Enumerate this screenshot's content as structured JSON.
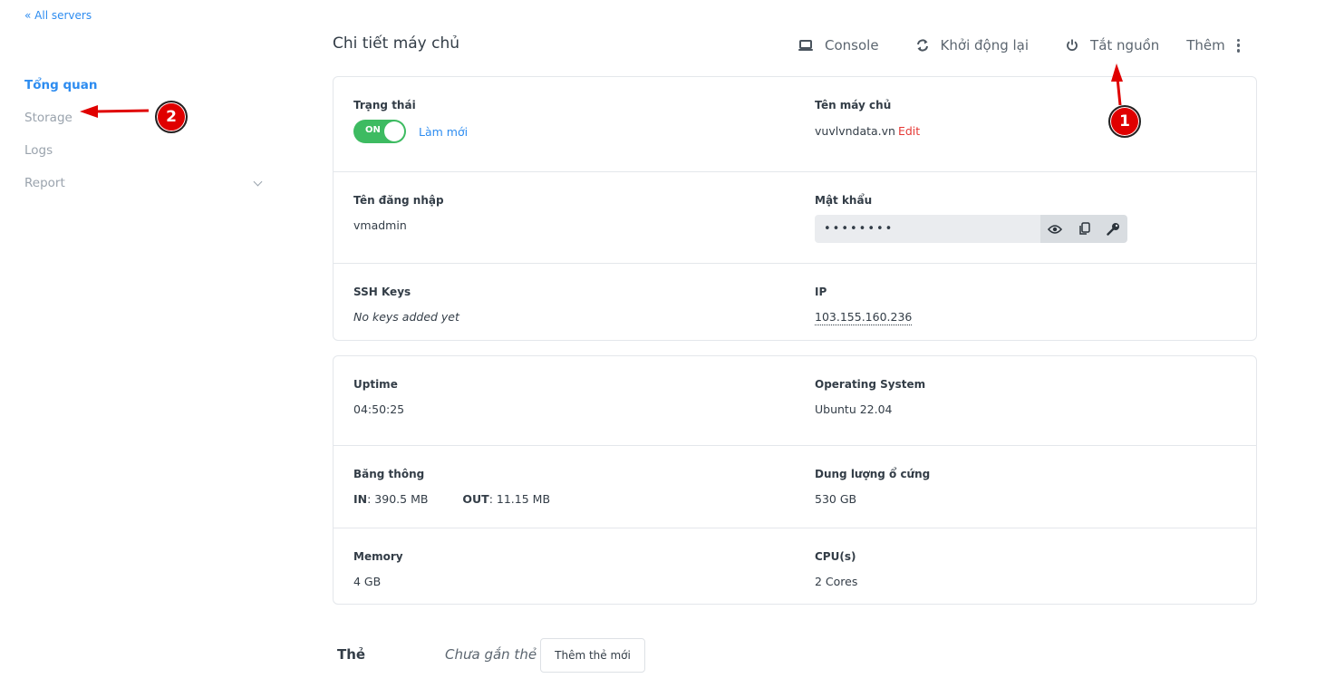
{
  "nav": {
    "back_link": "« All servers",
    "items": [
      {
        "label": "Tổng quan",
        "active": true
      },
      {
        "label": "Storage",
        "active": false
      },
      {
        "label": "Logs",
        "active": false
      },
      {
        "label": "Report",
        "active": false
      }
    ]
  },
  "header": {
    "title": "Chi tiết máy chủ",
    "actions": {
      "console": {
        "label": "Console",
        "icon": "laptop-icon"
      },
      "restart": {
        "label": "Khởi động lại",
        "icon": "refresh-icon"
      },
      "power_off": {
        "label": "Tắt nguồn",
        "icon": "power-icon"
      },
      "more": {
        "label": "Thêm",
        "icon": "kebab-icon"
      }
    }
  },
  "details": {
    "status": {
      "label": "Trạng thái",
      "toggle": "ON",
      "refresh": "Làm mới"
    },
    "hostname": {
      "label": "Tên máy chủ",
      "value": "vuvlvndata.vn",
      "edit": "Edit"
    },
    "username": {
      "label": "Tên đăng nhập",
      "value": "vmadmin"
    },
    "password": {
      "label": "Mật khẩu",
      "value": "••••••••"
    },
    "ssh_keys": {
      "label": "SSH Keys",
      "value": "No keys added yet"
    },
    "ip": {
      "label": "IP",
      "value": "103.155.160.236"
    }
  },
  "stats": {
    "uptime": {
      "label": "Uptime",
      "value": "04:50:25"
    },
    "os": {
      "label": "Operating System",
      "value": "Ubuntu 22.04"
    },
    "bandwidth": {
      "label": "Băng thông",
      "in_label": "IN",
      "in_value": ": 390.5 MB",
      "out_label": "OUT",
      "out_value": ": 11.15 MB"
    },
    "disk": {
      "label": "Dung lượng ổ cứng",
      "value": "530 GB"
    },
    "memory": {
      "label": "Memory",
      "value": "4 GB"
    },
    "cpu": {
      "label": "CPU(s)",
      "value": "2 Cores"
    }
  },
  "tags": {
    "label": "Thẻ",
    "empty": "Chưa gắn thẻ",
    "add_button": "Thêm thẻ mới"
  },
  "annotations": {
    "one": "1",
    "two": "2",
    "color": "#e00000"
  }
}
